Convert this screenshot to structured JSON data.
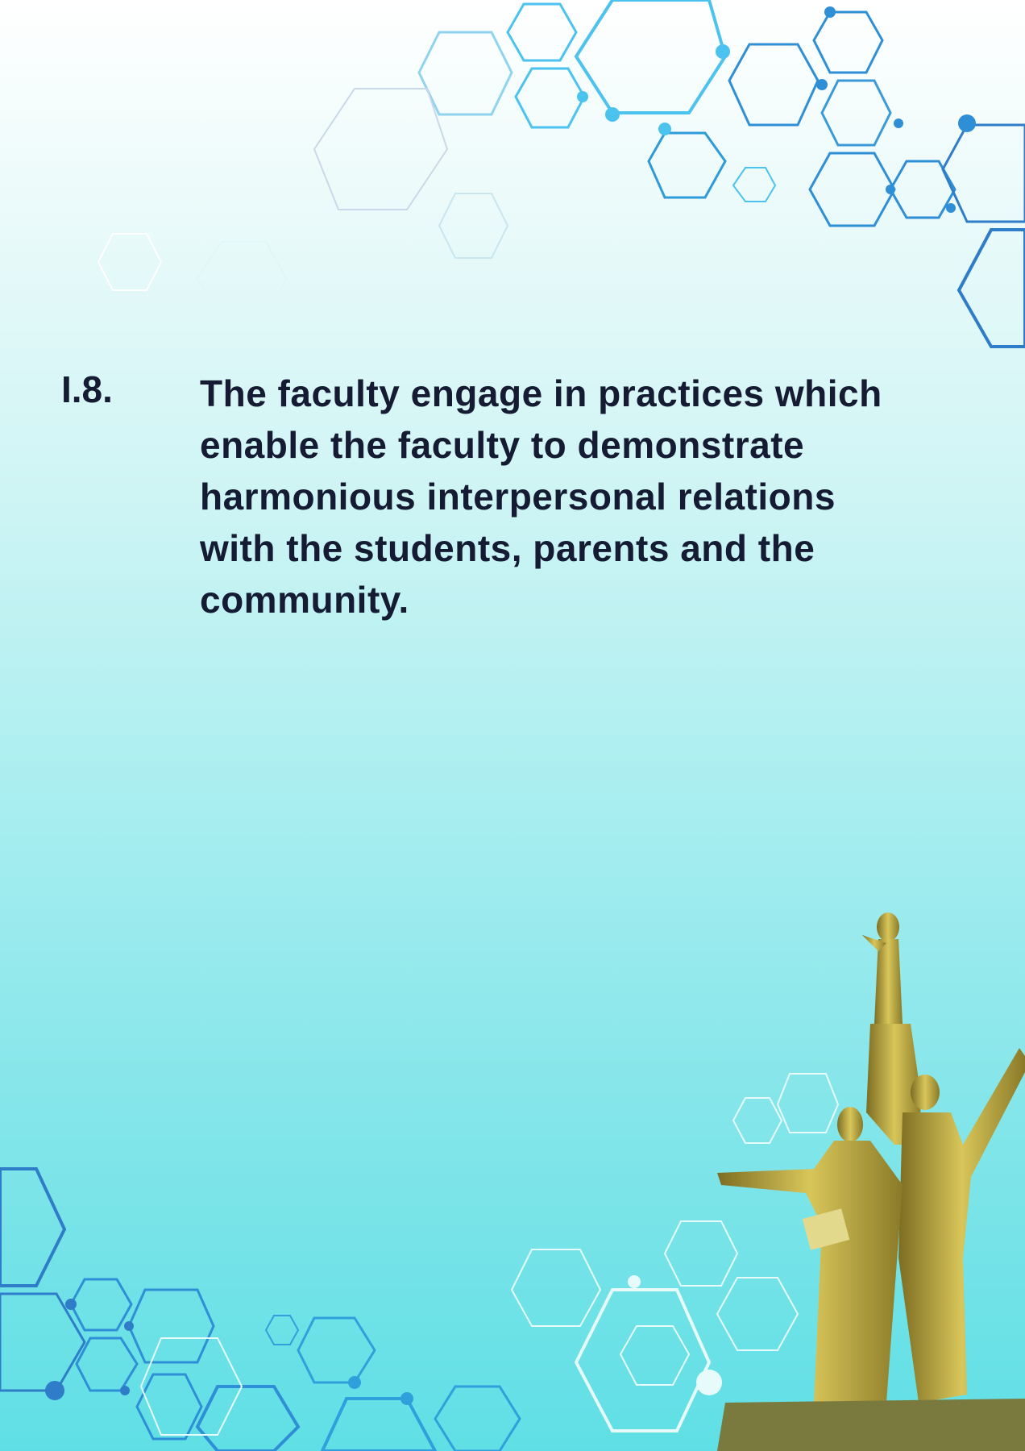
{
  "item": {
    "number": "I.8.",
    "lines": [
      "The faculty engage in practices which",
      "enable the faculty to demonstrate",
      "harmonious interpersonal relations",
      "with the students, parents and the",
      "community."
    ]
  },
  "colors": {
    "text": "#141b33",
    "hex_blue": "#2f8fd6",
    "statue_gold": "#b8a940"
  },
  "icons": [
    "hexagon-pattern-top",
    "hexagon-pattern-bottom",
    "statue-illustration"
  ]
}
